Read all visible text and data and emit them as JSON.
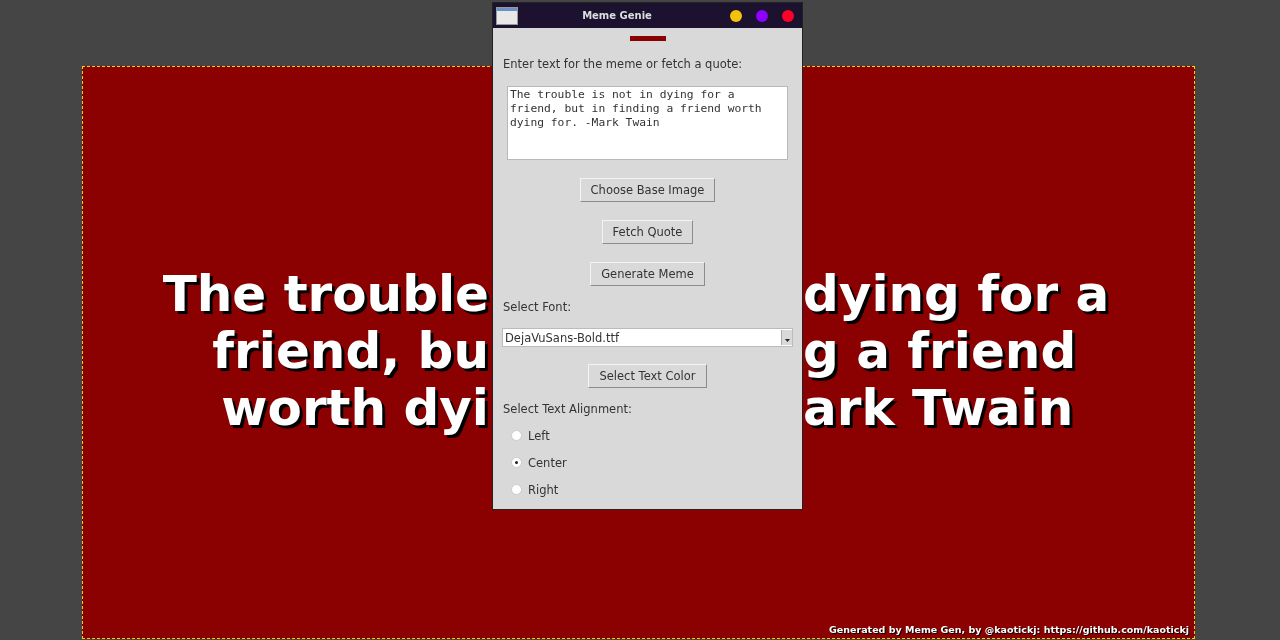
{
  "meme": {
    "lines": [
      {
        "left": "The trouble",
        "right": "dying for a"
      },
      {
        "left": "friend, bu",
        "right": "g a friend"
      },
      {
        "left": "worth dyi",
        "right": "ark Twain"
      }
    ],
    "credit": "Generated by Meme Gen, by @kaotickj: https://github.com/kaotickj"
  },
  "window": {
    "title": "Meme Genie"
  },
  "prompt": "Enter text for the meme or fetch a quote:",
  "meme_text_field": {
    "value": "The trouble is not in dying for a friend, but in finding a friend worth dying for. -Mark Twain"
  },
  "buttons": [
    "Choose Base Image",
    "Fetch Quote",
    "Generate Meme"
  ],
  "font_label": "Select Font:",
  "font_select": {
    "value": "DejaVuSans-Bold.ttf"
  },
  "color_button": "Select Text Color",
  "alignment_label": "Select Text Alignment:",
  "alignments": [
    {
      "label": "Left",
      "selected": false
    },
    {
      "label": "Center",
      "selected": true
    },
    {
      "label": "Right",
      "selected": false
    }
  ]
}
